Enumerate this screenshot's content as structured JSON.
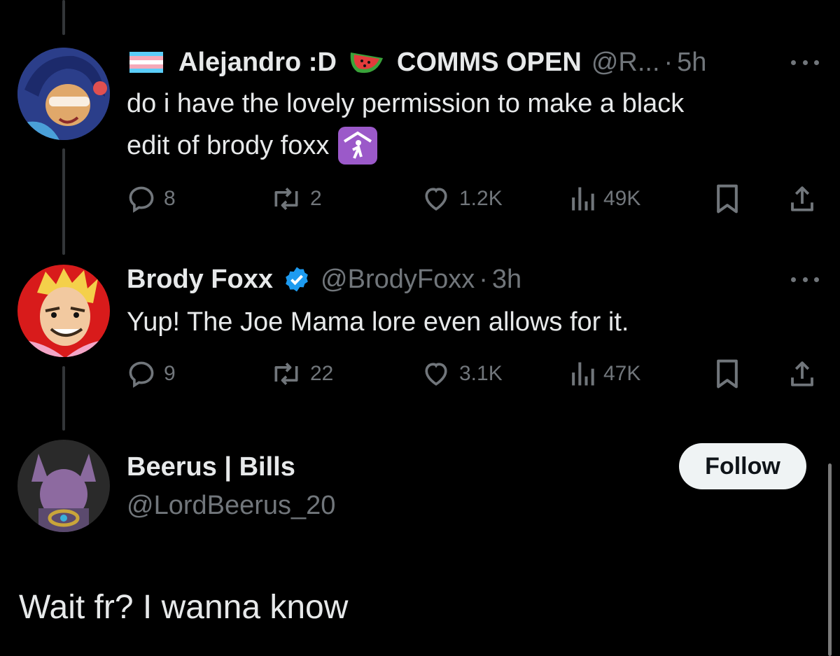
{
  "thread": {
    "tweets": [
      {
        "name": "Alejandro :D",
        "name_suffix": "COMMS OPEN",
        "handle": "@R...",
        "separator": "·",
        "time": "5h",
        "text_line1": "do i have the lovely permission to make a black",
        "text_line2": "edit of brody foxx",
        "stats": {
          "replies": "8",
          "reposts": "2",
          "likes": "1.2K",
          "views": "49K"
        },
        "icons": [
          "trans-flag-icon",
          "watermelon-icon",
          "worship-symbol-icon"
        ]
      },
      {
        "name": "Brody Foxx",
        "handle": "@BrodyFoxx",
        "separator": "·",
        "time": "3h",
        "text": "Yup! The Joe Mama lore even allows for it.",
        "verified": true,
        "stats": {
          "replies": "9",
          "reposts": "22",
          "likes": "3.1K",
          "views": "47K"
        }
      }
    ]
  },
  "reply": {
    "name": "Beerus | Bills",
    "handle": "@LordBeerus_20",
    "follow_label": "Follow",
    "text": "Wait fr? I wanna know"
  },
  "colors": {
    "background": "#000000",
    "text": "#e7e9ea",
    "muted": "#71767b",
    "verified": "#1d9bf0",
    "follow_bg": "#eff3f4"
  }
}
